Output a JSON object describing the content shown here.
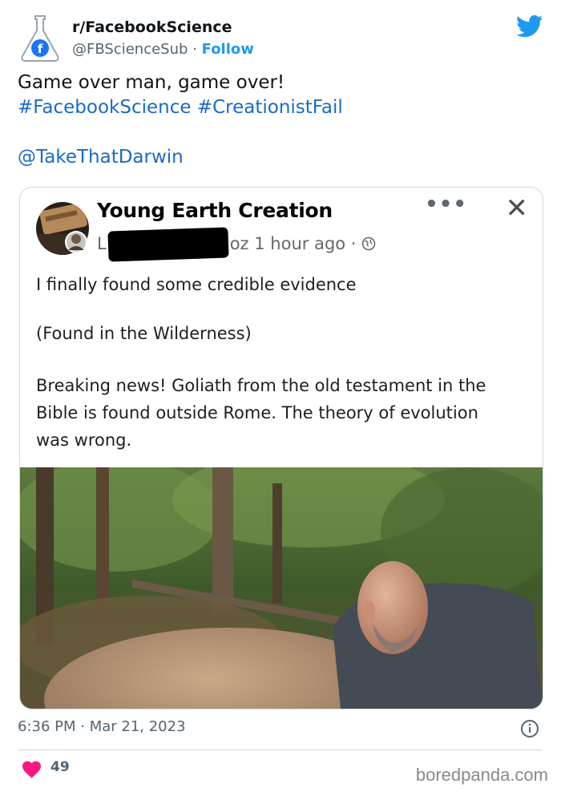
{
  "account": {
    "display_name": "r/FacebookScience",
    "handle": "@FBScienceSub",
    "separator": "·",
    "follow_label": "Follow"
  },
  "tweet": {
    "line1": "Game over man, game over!",
    "hashtag1": "#FacebookScience",
    "hashtag2": "#CreationistFail",
    "mention": "@TakeThatDarwin",
    "timestamp": "6:36 PM · Mar 21, 2023",
    "likes": "49"
  },
  "fb_post": {
    "page_name": "Young Earth Creation",
    "author_initial": "L",
    "author_tail": "oz",
    "time_ago": "1 hour ago ·",
    "more_label": "•••",
    "close_label": "✕",
    "headline": "I finally found some credible evidence",
    "location": "(Found in the Wilderness)",
    "body_line1": "Breaking news! Goliath from the old testament in the",
    "body_line2": "Bible is found outside Rome.  The theory of evolution",
    "body_line3": "was wrong."
  },
  "watermark": "boredpanda.com",
  "icons": {
    "avatar": "flask-facebook-icon",
    "platform": "twitter-bird-icon",
    "info": "info-icon",
    "like": "heart-icon",
    "globe": "globe-icon"
  },
  "colors": {
    "link": "#1b6ac9",
    "follow": "#1d9bf0",
    "heart": "#f91880"
  }
}
